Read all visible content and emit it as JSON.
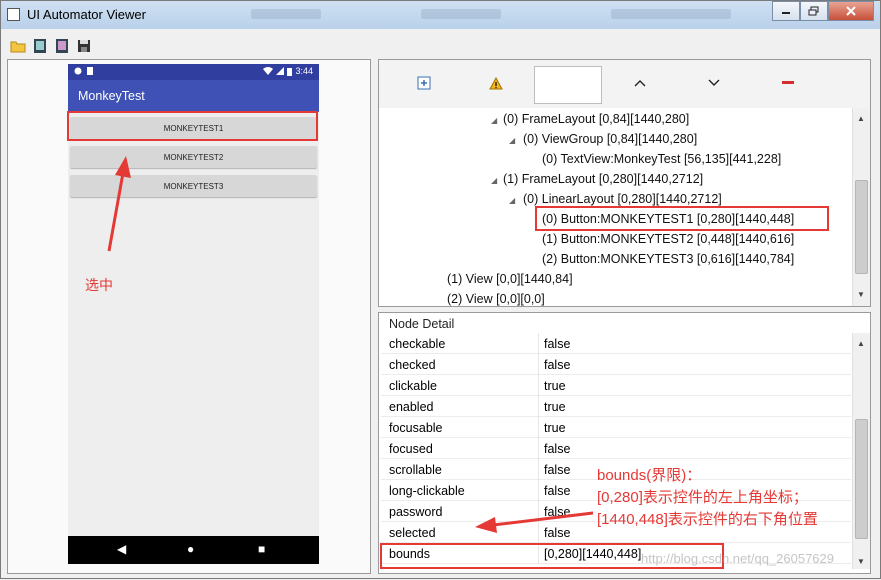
{
  "window": {
    "title": "UI Automator Viewer"
  },
  "phone": {
    "status_time": "3:44",
    "app_title": "MonkeyTest",
    "buttons": [
      "MONKEYTEST1",
      "MONKEYTEST2",
      "MONKEYTEST3"
    ]
  },
  "annotations": {
    "selected_label": "选中",
    "bounds_title": "bounds(界限)：",
    "bounds_topleft": "[0,280]表示控件的左上角坐标；",
    "bounds_bottomright": "[1440,448]表示控件的右下角位置"
  },
  "tree": [
    {
      "text": "(0) FrameLayout [0,84][1440,280]"
    },
    {
      "text": "(0) ViewGroup [0,84][1440,280]"
    },
    {
      "text": "(0) TextView:MonkeyTest [56,135][441,228]"
    },
    {
      "text": "(1) FrameLayout [0,280][1440,2712]"
    },
    {
      "text": "(0) LinearLayout [0,280][1440,2712]"
    },
    {
      "text": "(0) Button:MONKEYTEST1 [0,280][1440,448]"
    },
    {
      "text": "(1) Button:MONKEYTEST2 [0,448][1440,616]"
    },
    {
      "text": "(2) Button:MONKEYTEST3 [0,616][1440,784]"
    },
    {
      "text": "(1) View [0,0][1440,84]"
    },
    {
      "text": "(2) View [0,0][0,0]"
    }
  ],
  "node_detail": {
    "label": "Node Detail",
    "rows": [
      {
        "key": "checkable",
        "value": "false"
      },
      {
        "key": "checked",
        "value": "false"
      },
      {
        "key": "clickable",
        "value": "true"
      },
      {
        "key": "enabled",
        "value": "true"
      },
      {
        "key": "focusable",
        "value": "true"
      },
      {
        "key": "focused",
        "value": "false"
      },
      {
        "key": "scrollable",
        "value": "false"
      },
      {
        "key": "long-clickable",
        "value": "false"
      },
      {
        "key": "password",
        "value": "false"
      },
      {
        "key": "selected",
        "value": "false"
      },
      {
        "key": "bounds",
        "value": "[0,280][1440,448]"
      }
    ]
  },
  "watermark": "http://blog.csdn.net/qq_26057629",
  "colors": {
    "accent_red": "#e53935",
    "app_bar": "#3f51b5",
    "status_bar": "#303f9f"
  },
  "icons": [
    "open-folder-icon",
    "screenshot-icon",
    "compressed-screenshot-icon",
    "save-icon",
    "expand-all-icon",
    "warning-icon",
    "chevron-up-icon",
    "chevron-down-icon",
    "minus-icon"
  ]
}
